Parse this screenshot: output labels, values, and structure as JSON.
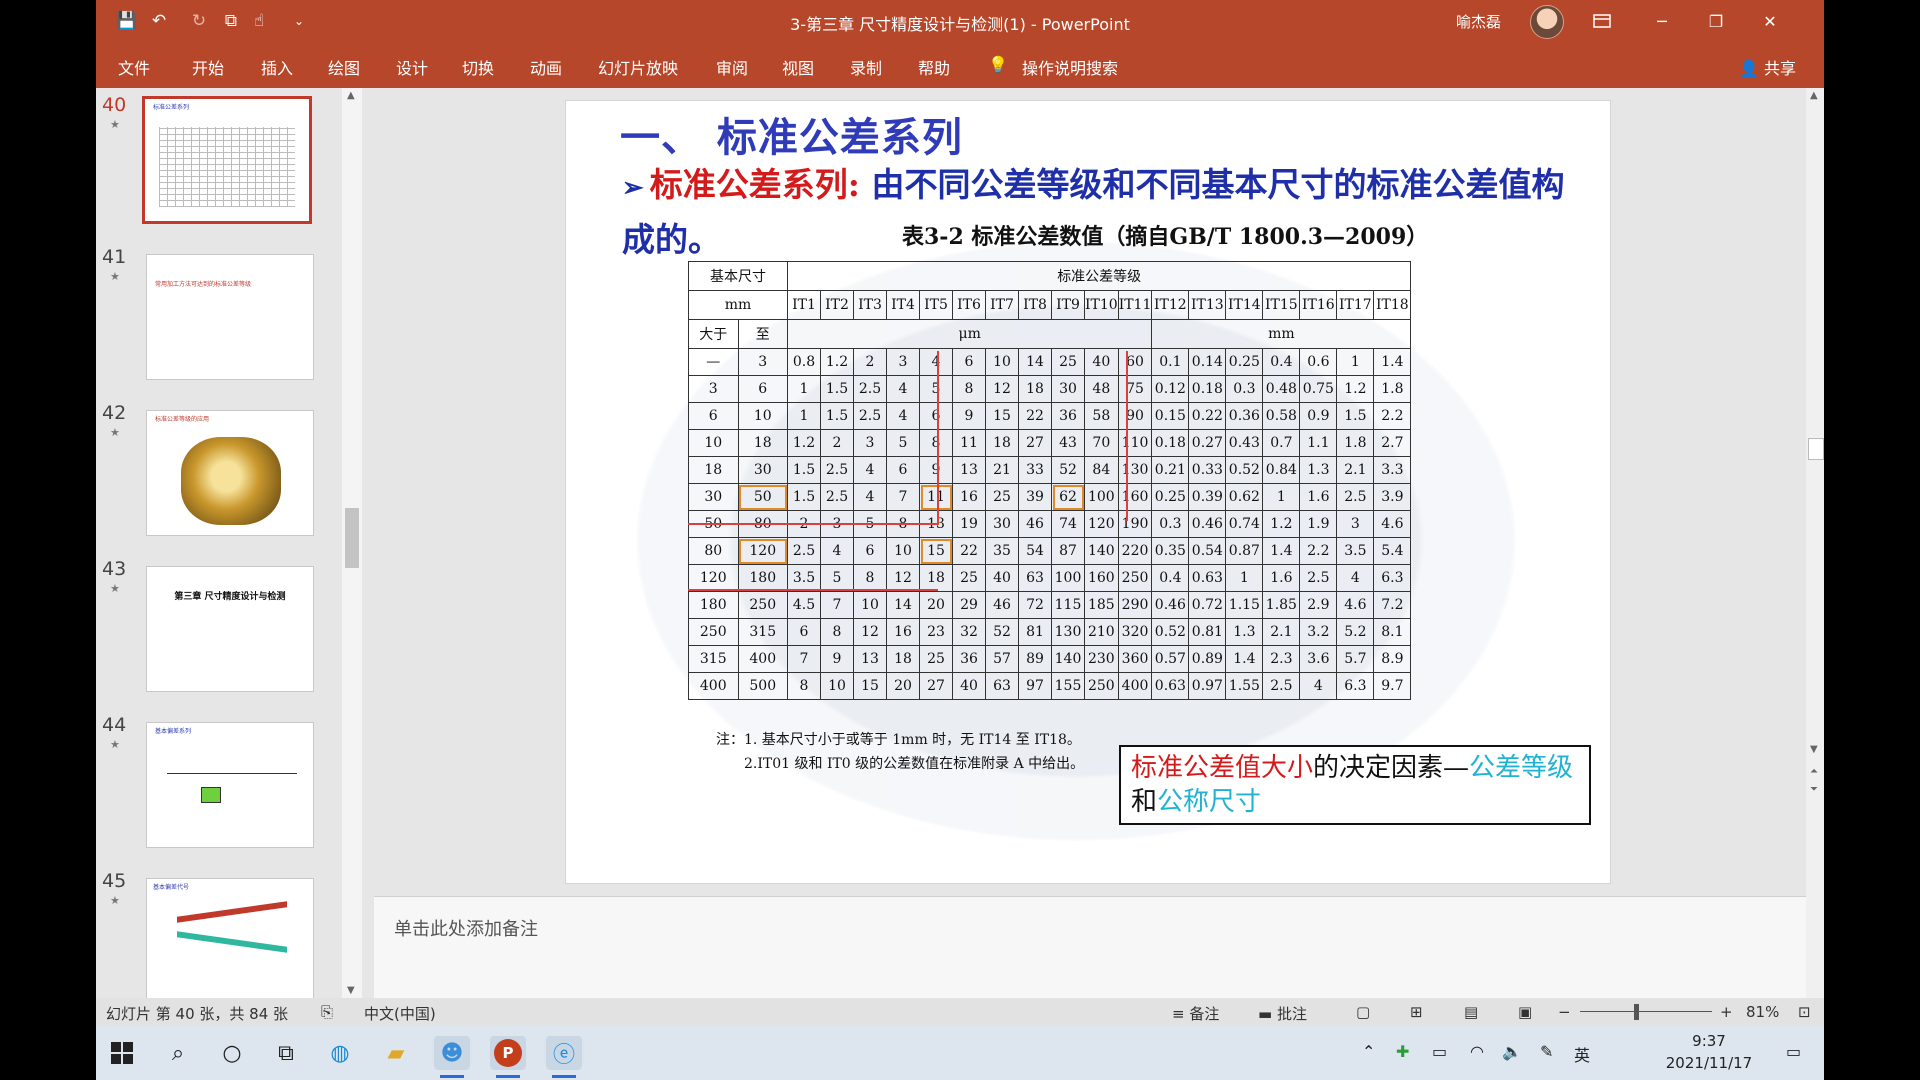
{
  "window": {
    "title": "3-第三章 尺寸精度设计与检测(1)  -  PowerPoint",
    "user_name": "喻杰磊",
    "ribbon_display_icon": "ribbon-display-icon",
    "minimize": "─",
    "maximize": "❐",
    "close": "✕"
  },
  "quick_access": {
    "save_icon": "💾",
    "undo_icon": "↶",
    "redo_icon": "↻",
    "present_icon": "⧉",
    "touch_icon": "☝",
    "customize_icon": "⌄"
  },
  "ribbon": {
    "tabs": [
      "文件",
      "开始",
      "插入",
      "绘图",
      "设计",
      "切换",
      "动画",
      "幻灯片放映",
      "审阅",
      "视图",
      "录制",
      "帮助"
    ],
    "search_label": "操作说明搜索",
    "share_label": "共享"
  },
  "thumbnails": [
    {
      "number": "40",
      "star": "★",
      "preview": "标准公差系列"
    },
    {
      "number": "41",
      "star": "★",
      "preview": "常用加工方法可达到的标准公差等级"
    },
    {
      "number": "42",
      "star": "★",
      "preview": "标准公差等级的应用"
    },
    {
      "number": "43",
      "star": "★",
      "preview": "第三章  尺寸精度设计与检测"
    },
    {
      "number": "44",
      "star": "★",
      "preview": "基本偏差系列"
    },
    {
      "number": "45",
      "star": "★",
      "preview": "基本偏差代号"
    }
  ],
  "slide": {
    "heading": "一、 标准公差系列",
    "bullet_red": "标准公差系列:",
    "bullet_rest": " 由不同公差等级和不同基本尺寸的标准公差值构成的。",
    "table_caption": "表3-2  标准公差数值（摘自GB/T 1800.3—2009）",
    "table": {
      "size_header": "基本尺寸",
      "size_unit": "mm",
      "grade_header": "标准公差等级",
      "col_over": "大于",
      "col_to": "至",
      "grades": [
        "IT1",
        "IT2",
        "IT3",
        "IT4",
        "IT5",
        "IT6",
        "IT7",
        "IT8",
        "IT9",
        "IT10",
        "IT11",
        "IT12",
        "IT13",
        "IT14",
        "IT15",
        "IT16",
        "IT17",
        "IT18"
      ],
      "unit_um": "μm",
      "unit_mm": "mm",
      "rows": [
        [
          "—",
          "3",
          "0.8",
          "1.2",
          "2",
          "3",
          "4",
          "6",
          "10",
          "14",
          "25",
          "40",
          "60",
          "0.1",
          "0.14",
          "0.25",
          "0.4",
          "0.6",
          "1",
          "1.4"
        ],
        [
          "3",
          "6",
          "1",
          "1.5",
          "2.5",
          "4",
          "5",
          "8",
          "12",
          "18",
          "30",
          "48",
          "75",
          "0.12",
          "0.18",
          "0.3",
          "0.48",
          "0.75",
          "1.2",
          "1.8"
        ],
        [
          "6",
          "10",
          "1",
          "1.5",
          "2.5",
          "4",
          "6",
          "9",
          "15",
          "22",
          "36",
          "58",
          "90",
          "0.15",
          "0.22",
          "0.36",
          "0.58",
          "0.9",
          "1.5",
          "2.2"
        ],
        [
          "10",
          "18",
          "1.2",
          "2",
          "3",
          "5",
          "8",
          "11",
          "18",
          "27",
          "43",
          "70",
          "110",
          "0.18",
          "0.27",
          "0.43",
          "0.7",
          "1.1",
          "1.8",
          "2.7"
        ],
        [
          "18",
          "30",
          "1.5",
          "2.5",
          "4",
          "6",
          "9",
          "13",
          "21",
          "33",
          "52",
          "84",
          "130",
          "0.21",
          "0.33",
          "0.52",
          "0.84",
          "1.3",
          "2.1",
          "3.3"
        ],
        [
          "30",
          "50",
          "1.5",
          "2.5",
          "4",
          "7",
          "11",
          "16",
          "25",
          "39",
          "62",
          "100",
          "160",
          "0.25",
          "0.39",
          "0.62",
          "1",
          "1.6",
          "2.5",
          "3.9"
        ],
        [
          "50",
          "80",
          "2",
          "3",
          "5",
          "8",
          "13",
          "19",
          "30",
          "46",
          "74",
          "120",
          "190",
          "0.3",
          "0.46",
          "0.74",
          "1.2",
          "1.9",
          "3",
          "4.6"
        ],
        [
          "80",
          "120",
          "2.5",
          "4",
          "6",
          "10",
          "15",
          "22",
          "35",
          "54",
          "87",
          "140",
          "220",
          "0.35",
          "0.54",
          "0.87",
          "1.4",
          "2.2",
          "3.5",
          "5.4"
        ],
        [
          "120",
          "180",
          "3.5",
          "5",
          "8",
          "12",
          "18",
          "25",
          "40",
          "63",
          "100",
          "160",
          "250",
          "0.4",
          "0.63",
          "1",
          "1.6",
          "2.5",
          "4",
          "6.3"
        ],
        [
          "180",
          "250",
          "4.5",
          "7",
          "10",
          "14",
          "20",
          "29",
          "46",
          "72",
          "115",
          "185",
          "290",
          "0.46",
          "0.72",
          "1.15",
          "1.85",
          "2.9",
          "4.6",
          "7.2"
        ],
        [
          "250",
          "315",
          "6",
          "8",
          "12",
          "16",
          "23",
          "32",
          "52",
          "81",
          "130",
          "210",
          "320",
          "0.52",
          "0.81",
          "1.3",
          "2.1",
          "3.2",
          "5.2",
          "8.1"
        ],
        [
          "315",
          "400",
          "7",
          "9",
          "13",
          "18",
          "25",
          "36",
          "57",
          "89",
          "140",
          "230",
          "360",
          "0.57",
          "0.89",
          "1.4",
          "2.3",
          "3.6",
          "5.7",
          "8.9"
        ],
        [
          "400",
          "500",
          "8",
          "10",
          "15",
          "20",
          "27",
          "40",
          "63",
          "97",
          "155",
          "250",
          "400",
          "0.63",
          "0.97",
          "1.55",
          "2.5",
          "4",
          "6.3",
          "9.7"
        ]
      ]
    },
    "note1": "注：1. 基本尺寸小于或等于 1mm 时，无 IT14 至 IT18。",
    "note2": "2.IT01 级和 IT0 级的公差数值在标准附录 A 中给出。",
    "callout": {
      "part1": "标准公差值大小",
      "part2": "的决定因素—",
      "part3": "公差等级",
      "part4": "和",
      "part5": "公称尺寸"
    }
  },
  "notes_placeholder": "单击此处添加备注",
  "status": {
    "slide_info": "幻灯片 第 40 张，共 84 张",
    "language": "中文(中国)",
    "notes": "备注",
    "comments": "批注",
    "zoom": "81%"
  },
  "taskbar": {
    "time": "9:37",
    "date": "2021/11/17",
    "ime": "英"
  },
  "colors": {
    "titlebar": "#b7472a",
    "heading_blue": "#2f3bb8",
    "accent_red": "#d41b1b",
    "callout_cyan": "#1fb3d1",
    "highlight_orange": "#e08a2a"
  }
}
